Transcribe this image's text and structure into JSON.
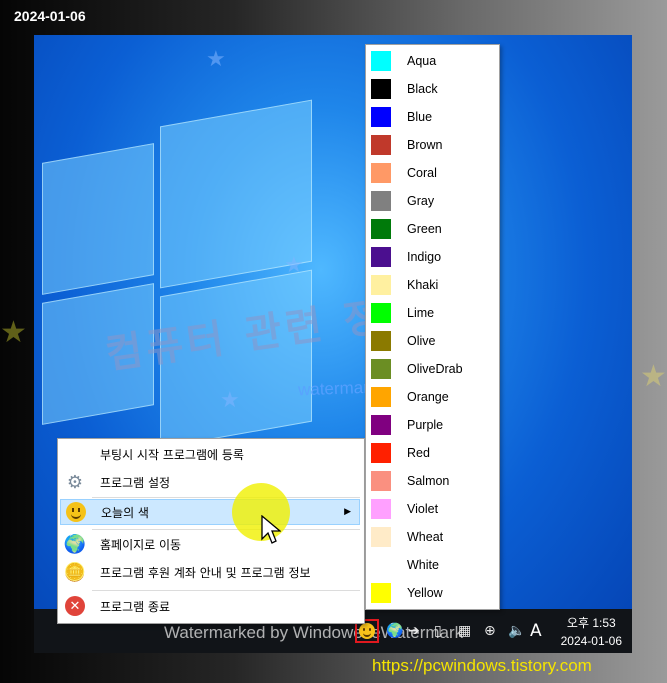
{
  "top_date": "2024-01-06",
  "watermark": {
    "korean": "컴퓨터 관련 정보",
    "english": "watermark by windowexe",
    "taskbar": "Watermarked by WindowexeWatermark"
  },
  "context_menu": {
    "items": [
      {
        "label": "부팅시 시작 프로그램에 등록",
        "icon": ""
      },
      {
        "label": "프로그램 설정",
        "icon": "gear-icon"
      },
      {
        "label": "오늘의 색",
        "icon": "smiley-icon",
        "selected": true,
        "has_submenu": true
      },
      {
        "label": "홈페이지로 이동",
        "icon": "globe-icon"
      },
      {
        "label": "프로그램 후원 계좌 안내 및 프로그램 정보",
        "icon": "coins-icon"
      },
      {
        "label": "프로그램 종료",
        "icon": "close-icon"
      }
    ],
    "submenu_arrow": "▶"
  },
  "color_menu": {
    "items": [
      {
        "name": "Aqua",
        "color": "#00FFFF"
      },
      {
        "name": "Black",
        "color": "#000000"
      },
      {
        "name": "Blue",
        "color": "#0000FF"
      },
      {
        "name": "Brown",
        "color": "#C0392B"
      },
      {
        "name": "Coral",
        "color": "#FF9966"
      },
      {
        "name": "Gray",
        "color": "#808080"
      },
      {
        "name": "Green",
        "color": "#007A0A"
      },
      {
        "name": "Indigo",
        "color": "#4B0F8F"
      },
      {
        "name": "Khaki",
        "color": "#FFF0A0"
      },
      {
        "name": "Lime",
        "color": "#00FF00"
      },
      {
        "name": "Olive",
        "color": "#8B7A00"
      },
      {
        "name": "OliveDrab",
        "color": "#6B8E23"
      },
      {
        "name": "Orange",
        "color": "#FFA500"
      },
      {
        "name": "Purple",
        "color": "#800080"
      },
      {
        "name": "Red",
        "color": "#FF2000"
      },
      {
        "name": "Salmon",
        "color": "#FA9080"
      },
      {
        "name": "Violet",
        "color": "#FFA0FF"
      },
      {
        "name": "Wheat",
        "color": "#FFEBC8"
      },
      {
        "name": "White",
        "color": "#FFFFFF"
      },
      {
        "name": "Yellow",
        "color": "#FFFF00"
      }
    ]
  },
  "taskbar": {
    "clock_period": "오후 1:53",
    "clock_date": "2024-01-06",
    "ime": "A"
  },
  "footer_url": "https://pcwindows.tistory.com"
}
